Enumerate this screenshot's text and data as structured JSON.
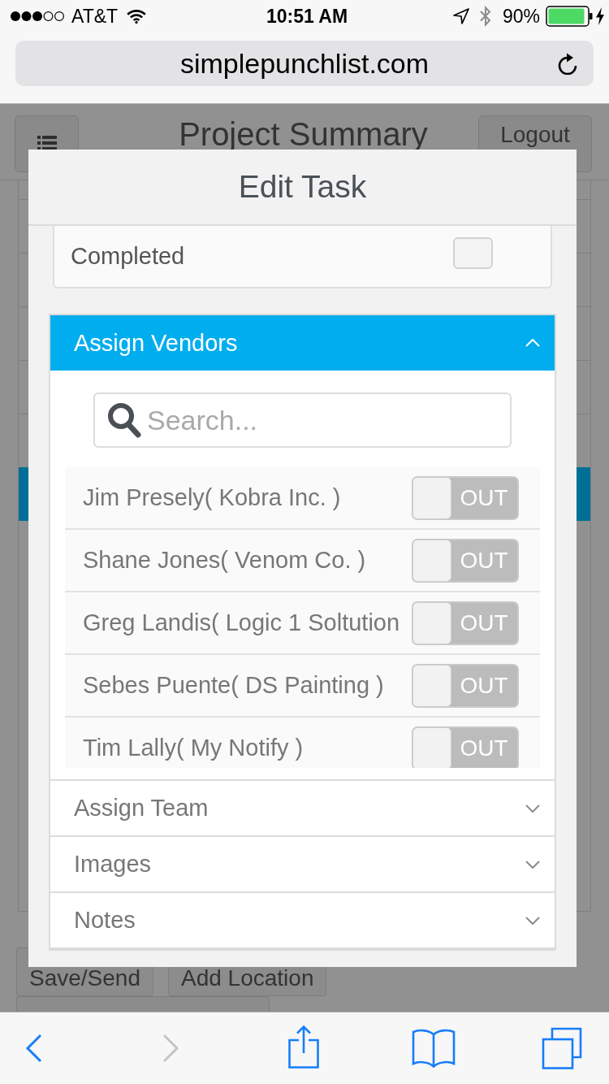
{
  "status_bar": {
    "carrier": "AT&T",
    "time": "10:51 AM",
    "battery": "90%"
  },
  "browser": {
    "url": "simplepunchlist.com"
  },
  "page": {
    "title": "Project Summary",
    "logout": "Logout",
    "list_rows": [
      {
        "selected": false
      },
      {
        "selected": false
      },
      {
        "selected": false
      },
      {
        "selected": false
      },
      {
        "selected": false
      },
      {
        "selected": true
      }
    ],
    "buttons": [
      "Save/Send",
      "Add Location"
    ]
  },
  "modal": {
    "title": "Edit Task",
    "completed": {
      "label": "Completed",
      "checked": false
    },
    "sections": [
      {
        "title": "Assign Vendors",
        "expanded": true,
        "search": {
          "placeholder": "Search..."
        },
        "vendors": [
          {
            "name": "Jim Presely( Kobra Inc. )",
            "toggle": "OUT",
            "on": false
          },
          {
            "name": "Shane Jones( Venom Co. )",
            "toggle": "OUT",
            "on": false
          },
          {
            "name": "Greg Landis( Logic 1 Soltution",
            "toggle": "OUT",
            "on": false
          },
          {
            "name": "Sebes Puente( DS Painting )",
            "toggle": "OUT",
            "on": false
          },
          {
            "name": "Tim Lally( My Notify )",
            "toggle": "OUT",
            "on": false
          }
        ]
      },
      {
        "title": "Assign Team",
        "expanded": false
      },
      {
        "title": "Images",
        "expanded": false
      },
      {
        "title": "Notes",
        "expanded": false
      }
    ]
  },
  "toolbar": [
    {
      "kind": "back",
      "disabled": false
    },
    {
      "kind": "forward",
      "disabled": true
    },
    {
      "kind": "share",
      "disabled": false
    },
    {
      "kind": "bookmarks",
      "disabled": false
    },
    {
      "kind": "tabs",
      "disabled": false
    }
  ]
}
